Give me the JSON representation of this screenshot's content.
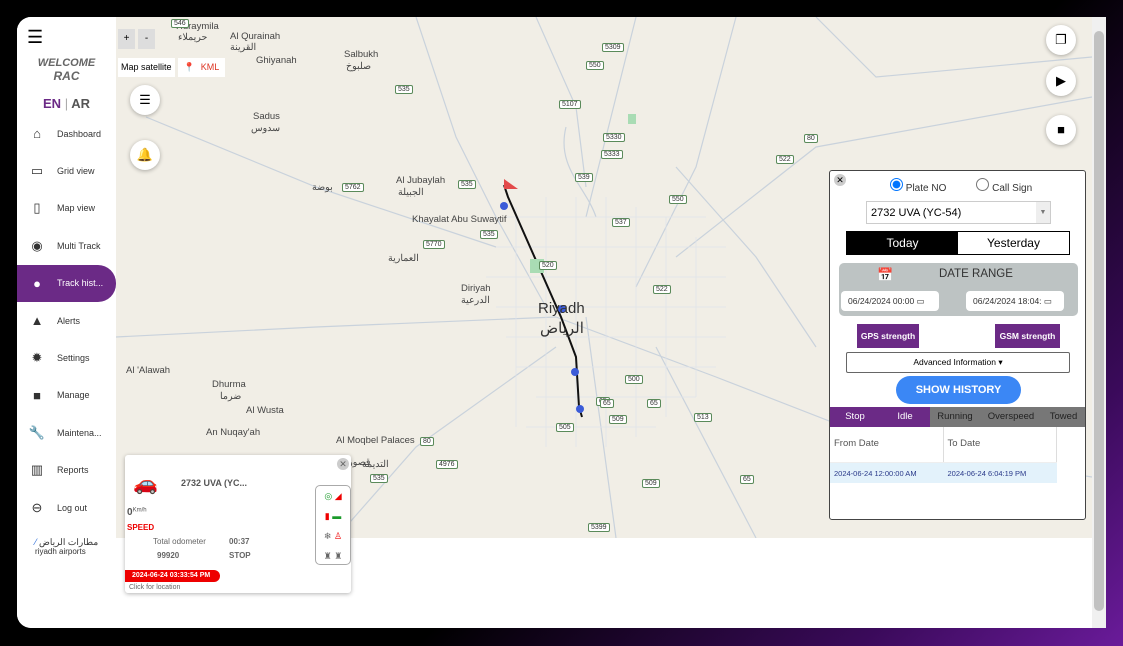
{
  "sidebar": {
    "welcome": "WELCOME",
    "user": "RAC",
    "lang_en": "EN",
    "lang_sep": "|",
    "lang_ar": "AR",
    "items": [
      {
        "label": "Dashboard",
        "icon": "home-icon"
      },
      {
        "label": "Grid view",
        "icon": "grid-icon"
      },
      {
        "label": "Map view",
        "icon": "map-icon"
      },
      {
        "label": "Multi Track",
        "icon": "multi-track-icon"
      },
      {
        "label": "Track hist...",
        "icon": "location-pin-icon",
        "active": true
      },
      {
        "label": "Alerts",
        "icon": "warning-icon"
      },
      {
        "label": "Settings",
        "icon": "gear-icon"
      },
      {
        "label": "Manage",
        "icon": "folder-icon"
      },
      {
        "label": "Maintena...",
        "icon": "wrench-icon"
      },
      {
        "label": "Reports",
        "icon": "bar-chart-icon"
      },
      {
        "label": "Log out",
        "icon": "logout-icon"
      }
    ],
    "logo_ar": "مطارات الرياض",
    "logo_en": "riyadh airports"
  },
  "map": {
    "zoom_in": "+",
    "zoom_out": "-",
    "map_type": "Map satellite",
    "kml": "KML",
    "labels": [
      "Huraymila",
      "حريملاء",
      "Al Qurainah",
      "القرينة",
      "Ghiyanah",
      "Salbukh",
      "صلبوخ",
      "Sadus",
      "سدوس",
      "Al Jubaylah",
      "الجبيلة",
      "Khayalat Abu Suwaytif",
      "العمارية",
      "Diriyah",
      "الدرعية",
      "Riyadh",
      "الرياض",
      "Al 'Alawah",
      "Dhurma",
      "ضرما",
      "Al Wusta",
      "An Nuqay'ah",
      "Al Moqbel Palaces",
      "قصور آل",
      "التديمة",
      "بوضة"
    ],
    "shields": [
      "546",
      "535",
      "5309",
      "550",
      "5107",
      "5330",
      "5333",
      "80",
      "522",
      "5762",
      "535",
      "539",
      "550",
      "537",
      "535",
      "5770",
      "520",
      "522",
      "65",
      "500",
      "65",
      "65",
      "513",
      "505",
      "509",
      "80",
      "4976",
      "535",
      "509",
      "65",
      "5399"
    ]
  },
  "panel": {
    "plate_label": "Plate NO",
    "callsign_label": "Call Sign",
    "vehicle": "2732 UVA (YC-54)",
    "today": "Today",
    "yesterday": "Yesterday",
    "date_range": "DATE RANGE",
    "from": "06/24/2024 00:00",
    "to": "06/24/2024 18:04:",
    "gps": "GPS strength",
    "gsm": "GSM strength",
    "advanced": "Advanced Information",
    "show": "SHOW HISTORY",
    "tabs": [
      "Stop",
      "Idle",
      "Running",
      "Overspeed",
      "Towed"
    ],
    "columns": [
      "From Date",
      "To Date"
    ],
    "rows": [
      [
        "2024-06-24 12:00:00 AM",
        "2024-06-24 6:04:19 PM"
      ]
    ]
  },
  "vehicle_popup": {
    "name": "2732 UVA (YC...",
    "speed": "0",
    "speed_unit": "Km/h",
    "speed_label": "SPEED",
    "odometer_label": "Total odometer",
    "odometer": "99920",
    "duration": "00:37",
    "status": "STOP",
    "timestamp": "2024-06-24 03:33:54 PM",
    "hint": "Click for location"
  },
  "colors": {
    "accent": "#6b2a86",
    "button": "#3b87f5",
    "alert": "#e00000"
  }
}
